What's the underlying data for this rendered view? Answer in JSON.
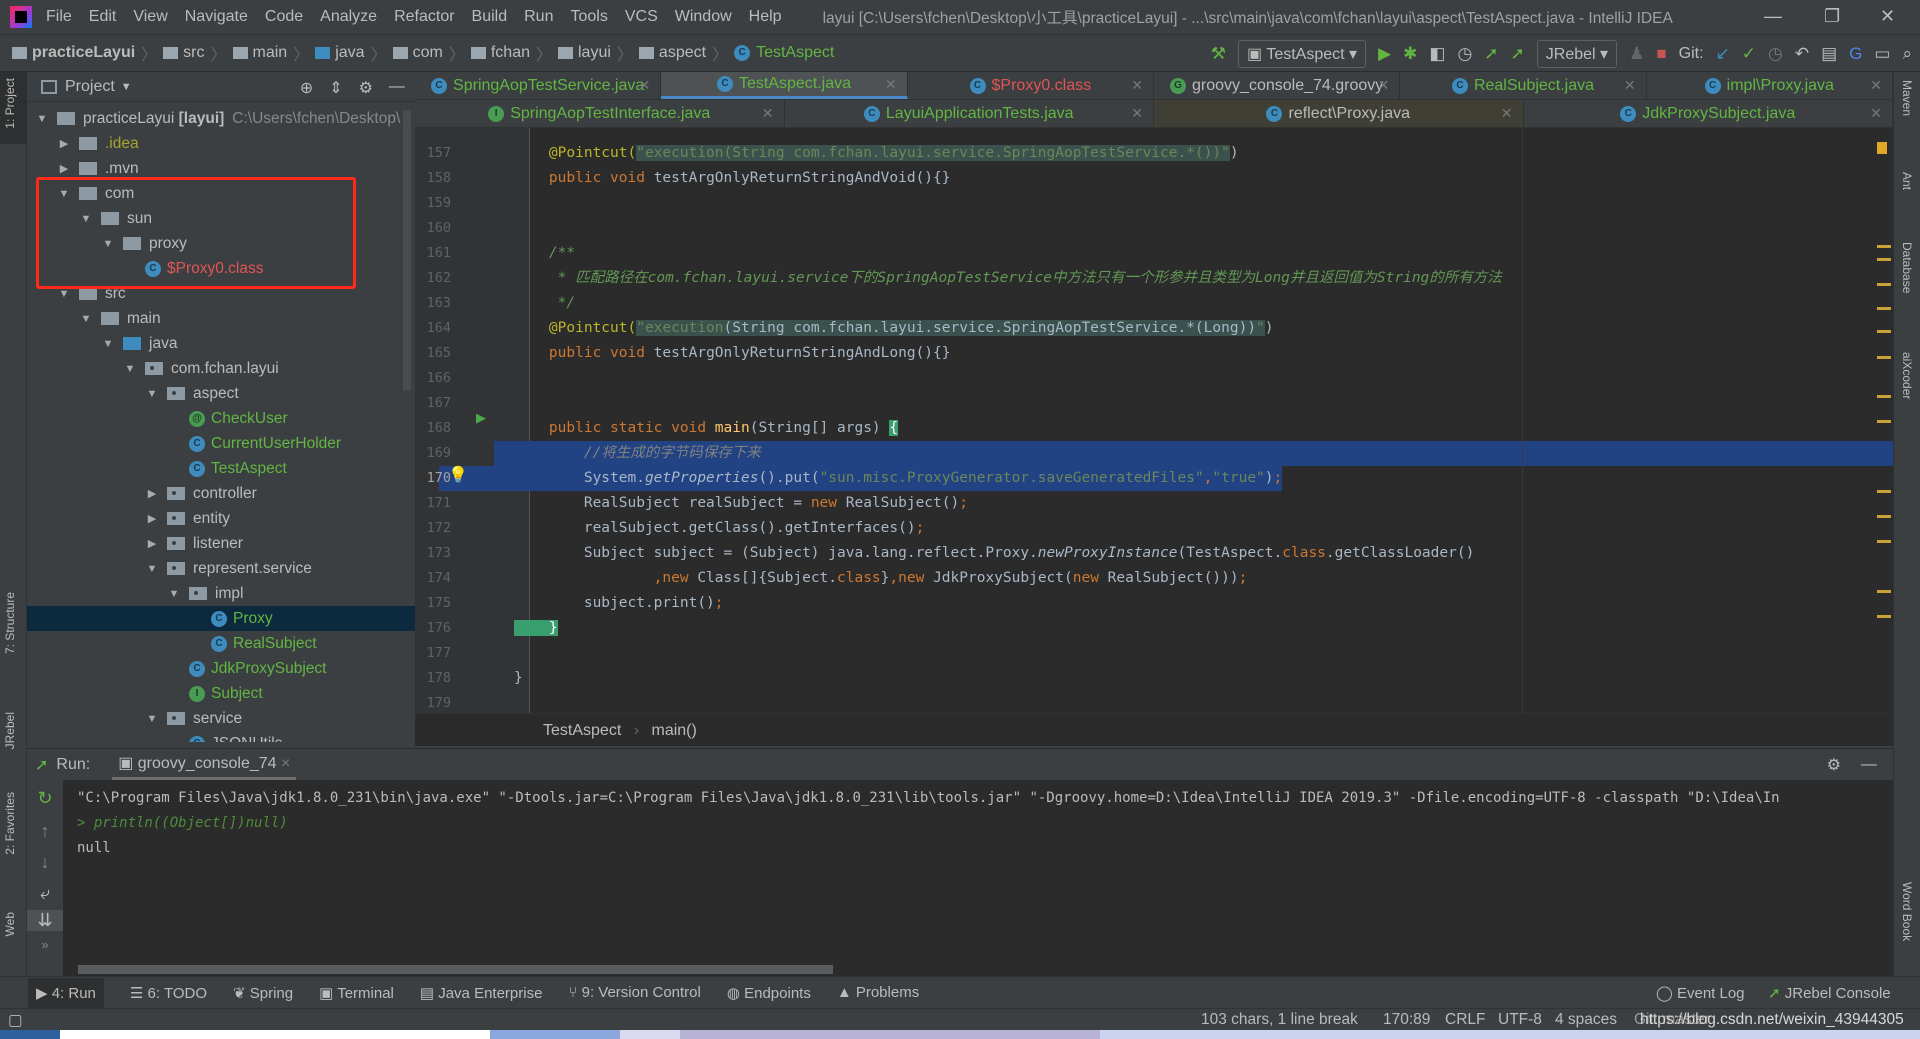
{
  "menubar": {
    "items": [
      "File",
      "Edit",
      "View",
      "Navigate",
      "Code",
      "Analyze",
      "Refactor",
      "Build",
      "Run",
      "Tools",
      "VCS",
      "Window",
      "Help"
    ],
    "title": "layui [C:\\Users\\fchen\\Desktop\\小工具\\practiceLayui] - ...\\src\\main\\java\\com\\fchan\\layui\\aspect\\TestAspect.java - IntelliJ IDEA"
  },
  "breadcrumb": [
    "practiceLayui",
    "src",
    "main",
    "java",
    "com",
    "fchan",
    "layui",
    "aspect",
    "TestAspect"
  ],
  "toolbar": {
    "run_config": "TestAspect",
    "jrebel": "JRebel",
    "git_label": "Git:"
  },
  "project": {
    "title": "Project",
    "tree": [
      {
        "label": "practiceLayui [layui]",
        "hint": "C:\\Users\\fchen\\Desktop\\",
        "depth": 0,
        "arrow": "open",
        "icon": "module",
        "color": "#bbbbbb"
      },
      {
        "label": ".idea",
        "depth": 1,
        "arrow": "closed",
        "icon": "folder",
        "color": "#a5a52e"
      },
      {
        "label": ".mvn",
        "depth": 1,
        "arrow": "closed",
        "icon": "folder",
        "color": "#bbbbbb"
      },
      {
        "label": "com",
        "depth": 1,
        "arrow": "open",
        "icon": "folder",
        "color": "#bbbbbb"
      },
      {
        "label": "sun",
        "depth": 2,
        "arrow": "open",
        "icon": "folder",
        "color": "#bbbbbb"
      },
      {
        "label": "proxy",
        "depth": 3,
        "arrow": "open",
        "icon": "folder",
        "color": "#bbbbbb"
      },
      {
        "label": "$Proxy0.class",
        "depth": 4,
        "arrow": "none",
        "icon": "class",
        "color": "#e05555"
      },
      {
        "label": "src",
        "depth": 1,
        "arrow": "open",
        "icon": "folder",
        "color": "#bbbbbb"
      },
      {
        "label": "main",
        "depth": 2,
        "arrow": "open",
        "icon": "folder",
        "color": "#bbbbbb"
      },
      {
        "label": "java",
        "depth": 3,
        "arrow": "open",
        "icon": "source-folder",
        "color": "#bbbbbb"
      },
      {
        "label": "com.fchan.layui",
        "depth": 4,
        "arrow": "open",
        "icon": "package",
        "color": "#bbbbbb"
      },
      {
        "label": "aspect",
        "depth": 5,
        "arrow": "open",
        "icon": "package",
        "color": "#bbbbbb"
      },
      {
        "label": "CheckUser",
        "depth": 6,
        "arrow": "none",
        "icon": "annotation",
        "color": "#62b543"
      },
      {
        "label": "CurrentUserHolder",
        "depth": 6,
        "arrow": "none",
        "icon": "class",
        "color": "#62b543"
      },
      {
        "label": "TestAspect",
        "depth": 6,
        "arrow": "none",
        "icon": "class",
        "color": "#62b543"
      },
      {
        "label": "controller",
        "depth": 5,
        "arrow": "closed",
        "icon": "package",
        "color": "#bbbbbb"
      },
      {
        "label": "entity",
        "depth": 5,
        "arrow": "closed",
        "icon": "package",
        "color": "#bbbbbb"
      },
      {
        "label": "listener",
        "depth": 5,
        "arrow": "closed",
        "icon": "package",
        "color": "#bbbbbb"
      },
      {
        "label": "represent.service",
        "depth": 5,
        "arrow": "open",
        "icon": "package",
        "color": "#bbbbbb"
      },
      {
        "label": "impl",
        "depth": 6,
        "arrow": "open",
        "icon": "package",
        "color": "#bbbbbb"
      },
      {
        "label": "Proxy",
        "depth": 7,
        "arrow": "none",
        "icon": "class",
        "color": "#62b543",
        "selected": true
      },
      {
        "label": "RealSubject",
        "depth": 7,
        "arrow": "none",
        "icon": "class",
        "color": "#62b543"
      },
      {
        "label": "JdkProxySubject",
        "depth": 6,
        "arrow": "none",
        "icon": "class",
        "color": "#62b543"
      },
      {
        "label": "Subject",
        "depth": 6,
        "arrow": "none",
        "icon": "interface",
        "color": "#62b543"
      },
      {
        "label": "service",
        "depth": 5,
        "arrow": "open",
        "icon": "package",
        "color": "#bbbbbb"
      },
      {
        "label": "JSONUtils",
        "depth": 6,
        "arrow": "none",
        "icon": "class",
        "color": "#bbbbbb"
      }
    ]
  },
  "tabs_row1": [
    {
      "label": "SpringAopTestService.java",
      "icon": "class",
      "color": "#62b543"
    },
    {
      "label": "TestAspect.java",
      "icon": "class",
      "color": "#62b543",
      "active": true
    },
    {
      "label": "$Proxy0.class",
      "icon": "class",
      "color": "#e05555"
    },
    {
      "label": "groovy_console_74.groovy",
      "icon": "groovy",
      "color": "#bbbbbb"
    },
    {
      "label": "RealSubject.java",
      "icon": "class",
      "color": "#62b543"
    },
    {
      "label": "impl\\Proxy.java",
      "icon": "class",
      "color": "#62b543"
    }
  ],
  "tabs_row2": [
    {
      "label": "SpringAopTestInterface.java",
      "icon": "interface",
      "color": "#62b543"
    },
    {
      "label": "LayuiApplicationTests.java",
      "icon": "class",
      "color": "#62b543"
    },
    {
      "label": "reflect\\Proxy.java",
      "icon": "class",
      "color": "#bbbbbb",
      "highlight": true
    },
    {
      "label": "JdkProxySubject.java",
      "icon": "class",
      "color": "#62b543"
    }
  ],
  "code": [
    {
      "n": "157",
      "s": [
        [
          "an",
          "    @Pointcut("
        ],
        [
          "st br",
          "\"execution(String com.fchan.layui.service.SpringAopTestService.*())\""
        ],
        [
          "pl",
          ")"
        ]
      ]
    },
    {
      "n": "158",
      "s": [
        [
          "kw",
          "    public void "
        ],
        [
          "pl",
          "testArgOnlyReturnStringAndVoid(){}"
        ]
      ]
    },
    {
      "n": "159",
      "s": []
    },
    {
      "n": "160",
      "s": []
    },
    {
      "n": "161",
      "s": [
        [
          "doc",
          "    /**"
        ]
      ]
    },
    {
      "n": "162",
      "s": [
        [
          "doc",
          "     * 匹配路径在com.fchan.layui.service下的SpringAopTestService中方法只有一个形参并且类型为Long并且返回值为String的所有方法"
        ]
      ]
    },
    {
      "n": "163",
      "s": [
        [
          "doc",
          "     */"
        ]
      ]
    },
    {
      "n": "164",
      "s": [
        [
          "an",
          "    @Pointcut("
        ],
        [
          "st br",
          "\"execution"
        ],
        [
          "pl br",
          "(String com.fchan.layui.service.SpringAopTestService.*(Long))"
        ],
        [
          "st br",
          "\""
        ],
        [
          "pl",
          ")"
        ]
      ]
    },
    {
      "n": "165",
      "s": [
        [
          "kw",
          "    public void "
        ],
        [
          "pl",
          "testArgOnlyReturnStringAndLong(){}"
        ]
      ]
    },
    {
      "n": "166",
      "s": []
    },
    {
      "n": "167",
      "s": []
    },
    {
      "n": "168",
      "s": [
        [
          "kw",
          "    public static void "
        ],
        [
          "fn",
          "main"
        ],
        [
          "pl",
          "(String[] args) "
        ],
        [
          "bm",
          "{"
        ]
      ]
    },
    {
      "n": "169",
      "sel": true,
      "s": [
        [
          "cm",
          "        //将生成的字节码保存下来"
        ]
      ]
    },
    {
      "n": "170",
      "sel": true,
      "cur": true,
      "s": [
        [
          "pl",
          "        System."
        ],
        [
          "pl it",
          "getProperties"
        ],
        [
          "pl",
          "().put("
        ],
        [
          "st",
          "\"sun.misc.ProxyGenerator.saveGeneratedFiles\""
        ],
        [
          "kw",
          ","
        ],
        [
          "st",
          "\"true\""
        ],
        [
          "pl",
          ")"
        ],
        [
          "kw",
          ";"
        ]
      ]
    },
    {
      "n": "171",
      "s": [
        [
          "pl",
          "        RealSubject realSubject = "
        ],
        [
          "kw",
          "new "
        ],
        [
          "pl",
          "RealSubject()"
        ],
        [
          "kw",
          ";"
        ]
      ]
    },
    {
      "n": "172",
      "s": [
        [
          "pl",
          "        realSubject.getClass().getInterfaces()"
        ],
        [
          "kw",
          ";"
        ]
      ]
    },
    {
      "n": "173",
      "s": [
        [
          "pl",
          "        Subject subject = (Subject) java.lang.reflect.Proxy."
        ],
        [
          "pl it",
          "newProxyInstance"
        ],
        [
          "pl",
          "(TestAspect."
        ],
        [
          "kw",
          "class"
        ],
        [
          "pl",
          ".getClassLoader()"
        ]
      ]
    },
    {
      "n": "174",
      "s": [
        [
          "kw",
          "                ,new "
        ],
        [
          "pl",
          "Class[]{Subject."
        ],
        [
          "kw",
          "class"
        ],
        [
          "pl",
          "}"
        ],
        [
          "kw",
          ",new "
        ],
        [
          "pl",
          "JdkProxySubject("
        ],
        [
          "kw",
          "new "
        ],
        [
          "pl",
          "RealSubject()))"
        ],
        [
          "kw",
          ";"
        ]
      ]
    },
    {
      "n": "175",
      "s": [
        [
          "pl",
          "        subject.print()"
        ],
        [
          "kw",
          ";"
        ]
      ]
    },
    {
      "n": "176",
      "s": [
        [
          "bm",
          "    }"
        ]
      ]
    },
    {
      "n": "177",
      "s": []
    },
    {
      "n": "178",
      "s": [
        [
          "pl",
          "}"
        ]
      ]
    },
    {
      "n": "179",
      "s": []
    }
  ],
  "editor_breadcrumb": [
    "TestAspect",
    "main()"
  ],
  "run": {
    "label": "Run:",
    "tab": "groovy_console_74",
    "console": [
      {
        "text": "\"C:\\Program Files\\Java\\jdk1.8.0_231\\bin\\java.exe\" \"-Dtools.jar=C:\\Program Files\\Java\\jdk1.8.0_231\\lib\\tools.jar\" \"-Dgroovy.home=D:\\Idea\\IntelliJ IDEA 2019.3\" -Dfile.encoding=UTF-8 -classpath \"D:\\Idea\\In",
        "type": "plain"
      },
      {
        "text": "> println((Object[])null)",
        "type": "prompt"
      },
      {
        "text": "null",
        "type": "plain"
      }
    ]
  },
  "left_stripe": [
    "1: Project",
    "7: Structure",
    "JRebel",
    "2: Favorites",
    "Web"
  ],
  "right_stripe": [
    "Maven",
    "Ant",
    "Database",
    "aiXcoder",
    "Word Book"
  ],
  "bottom_tabs": [
    "4: Run",
    "6: TODO",
    "Spring",
    "Terminal",
    "Java Enterprise",
    "9: Version Control",
    "Endpoints",
    "Problems"
  ],
  "bottom_right": [
    "Event Log",
    "JRebel Console"
  ],
  "status": {
    "selection": "103 chars, 1 line break",
    "position": "170:89",
    "line_sep": "CRLF",
    "encoding": "UTF-8",
    "indent": "4 spaces",
    "git": "Git: master",
    "watermark": "https://blog.csdn.net/weixin_43944305"
  }
}
